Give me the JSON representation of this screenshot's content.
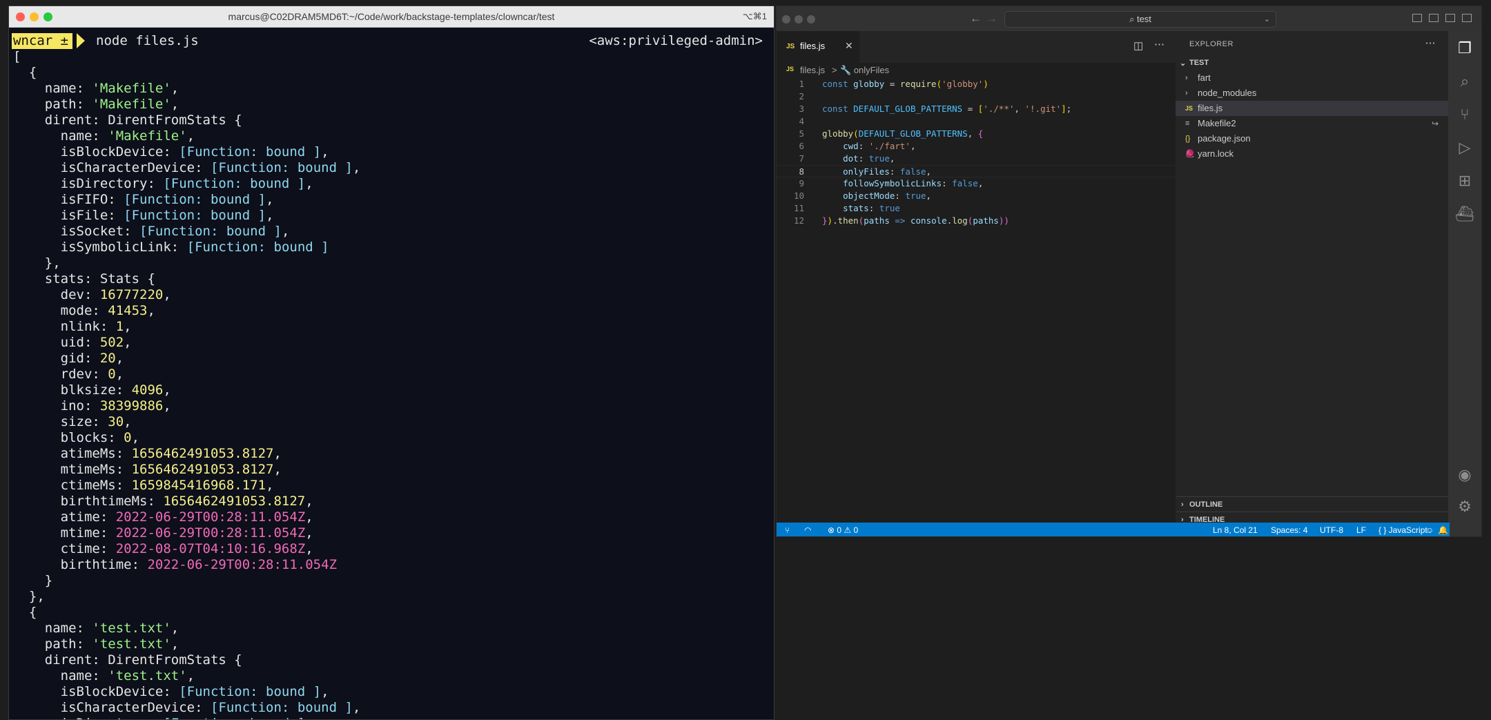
{
  "terminal": {
    "title": "marcus@C02DRAM5MD6T:~/Code/work/backstage-templates/clowncar/test",
    "shortcut": "⌥⌘1",
    "prompt_badge": "wncar ±",
    "command": "node files.js",
    "aws_context": "<aws:privileged-admin>",
    "lines": [
      [
        [
          "t",
          "["
        ]
      ],
      [
        [
          "t",
          "  {"
        ]
      ],
      [
        [
          "t",
          "    name: "
        ],
        [
          "s",
          "'Makefile'"
        ],
        [
          "t",
          ","
        ]
      ],
      [
        [
          "t",
          "    path: "
        ],
        [
          "s",
          "'Makefile'"
        ],
        [
          "t",
          ","
        ]
      ],
      [
        [
          "t",
          "    dirent: DirentFromStats {"
        ]
      ],
      [
        [
          "t",
          "      name: "
        ],
        [
          "s",
          "'Makefile'"
        ],
        [
          "t",
          ","
        ]
      ],
      [
        [
          "t",
          "      isBlockDevice: "
        ],
        [
          "f",
          "[Function: bound ]"
        ],
        [
          "t",
          ","
        ]
      ],
      [
        [
          "t",
          "      isCharacterDevice: "
        ],
        [
          "f",
          "[Function: bound ]"
        ],
        [
          "t",
          ","
        ]
      ],
      [
        [
          "t",
          "      isDirectory: "
        ],
        [
          "f",
          "[Function: bound ]"
        ],
        [
          "t",
          ","
        ]
      ],
      [
        [
          "t",
          "      isFIFO: "
        ],
        [
          "f",
          "[Function: bound ]"
        ],
        [
          "t",
          ","
        ]
      ],
      [
        [
          "t",
          "      isFile: "
        ],
        [
          "f",
          "[Function: bound ]"
        ],
        [
          "t",
          ","
        ]
      ],
      [
        [
          "t",
          "      isSocket: "
        ],
        [
          "f",
          "[Function: bound ]"
        ],
        [
          "t",
          ","
        ]
      ],
      [
        [
          "t",
          "      isSymbolicLink: "
        ],
        [
          "f",
          "[Function: bound ]"
        ]
      ],
      [
        [
          "t",
          "    },"
        ]
      ],
      [
        [
          "t",
          "    stats: Stats {"
        ]
      ],
      [
        [
          "t",
          "      dev: "
        ],
        [
          "n",
          "16777220"
        ],
        [
          "t",
          ","
        ]
      ],
      [
        [
          "t",
          "      mode: "
        ],
        [
          "n",
          "41453"
        ],
        [
          "t",
          ","
        ]
      ],
      [
        [
          "t",
          "      nlink: "
        ],
        [
          "n",
          "1"
        ],
        [
          "t",
          ","
        ]
      ],
      [
        [
          "t",
          "      uid: "
        ],
        [
          "n",
          "502"
        ],
        [
          "t",
          ","
        ]
      ],
      [
        [
          "t",
          "      gid: "
        ],
        [
          "n",
          "20"
        ],
        [
          "t",
          ","
        ]
      ],
      [
        [
          "t",
          "      rdev: "
        ],
        [
          "n",
          "0"
        ],
        [
          "t",
          ","
        ]
      ],
      [
        [
          "t",
          "      blksize: "
        ],
        [
          "n",
          "4096"
        ],
        [
          "t",
          ","
        ]
      ],
      [
        [
          "t",
          "      ino: "
        ],
        [
          "n",
          "38399886"
        ],
        [
          "t",
          ","
        ]
      ],
      [
        [
          "t",
          "      size: "
        ],
        [
          "n",
          "30"
        ],
        [
          "t",
          ","
        ]
      ],
      [
        [
          "t",
          "      blocks: "
        ],
        [
          "n",
          "0"
        ],
        [
          "t",
          ","
        ]
      ],
      [
        [
          "t",
          "      atimeMs: "
        ],
        [
          "n",
          "1656462491053.8127"
        ],
        [
          "t",
          ","
        ]
      ],
      [
        [
          "t",
          "      mtimeMs: "
        ],
        [
          "n",
          "1656462491053.8127"
        ],
        [
          "t",
          ","
        ]
      ],
      [
        [
          "t",
          "      ctimeMs: "
        ],
        [
          "n",
          "1659845416968.171"
        ],
        [
          "t",
          ","
        ]
      ],
      [
        [
          "t",
          "      birthtimeMs: "
        ],
        [
          "n",
          "1656462491053.8127"
        ],
        [
          "t",
          ","
        ]
      ],
      [
        [
          "t",
          "      atime: "
        ],
        [
          "d",
          "2022-06-29T00:28:11.054Z"
        ],
        [
          "t",
          ","
        ]
      ],
      [
        [
          "t",
          "      mtime: "
        ],
        [
          "d",
          "2022-06-29T00:28:11.054Z"
        ],
        [
          "t",
          ","
        ]
      ],
      [
        [
          "t",
          "      ctime: "
        ],
        [
          "d",
          "2022-08-07T04:10:16.968Z"
        ],
        [
          "t",
          ","
        ]
      ],
      [
        [
          "t",
          "      birthtime: "
        ],
        [
          "d",
          "2022-06-29T00:28:11.054Z"
        ]
      ],
      [
        [
          "t",
          "    }"
        ]
      ],
      [
        [
          "t",
          "  },"
        ]
      ],
      [
        [
          "t",
          "  {"
        ]
      ],
      [
        [
          "t",
          "    name: "
        ],
        [
          "s",
          "'test.txt'"
        ],
        [
          "t",
          ","
        ]
      ],
      [
        [
          "t",
          "    path: "
        ],
        [
          "s",
          "'test.txt'"
        ],
        [
          "t",
          ","
        ]
      ],
      [
        [
          "t",
          "    dirent: DirentFromStats {"
        ]
      ],
      [
        [
          "t",
          "      name: "
        ],
        [
          "s",
          "'test.txt'"
        ],
        [
          "t",
          ","
        ]
      ],
      [
        [
          "t",
          "      isBlockDevice: "
        ],
        [
          "f",
          "[Function: bound ]"
        ],
        [
          "t",
          ","
        ]
      ],
      [
        [
          "t",
          "      isCharacterDevice: "
        ],
        [
          "f",
          "[Function: bound ]"
        ],
        [
          "t",
          ","
        ]
      ],
      [
        [
          "t",
          "      isDirectory: "
        ],
        [
          "f",
          "[Function: bound ]"
        ],
        [
          "t",
          ","
        ]
      ]
    ]
  },
  "vscode": {
    "search": "test",
    "tab": {
      "badge": "JS",
      "label": "files.js"
    },
    "breadcrumb": {
      "file": "files.js",
      "separator": ">",
      "symbol": "onlyFiles"
    },
    "active_line": 8,
    "code_lines": [
      [
        [
          "k",
          "const "
        ],
        [
          "v",
          "globby"
        ],
        [
          "t",
          " = "
        ],
        [
          "f",
          "require"
        ],
        [
          "p1",
          "("
        ],
        [
          "s",
          "'globby'"
        ],
        [
          "p1",
          ")"
        ]
      ],
      [],
      [
        [
          "k",
          "const "
        ],
        [
          "cst",
          "DEFAULT_GLOB_PATTERNS"
        ],
        [
          "t",
          " = "
        ],
        [
          "p1",
          "["
        ],
        [
          "s",
          "'./**'"
        ],
        [
          "t",
          ", "
        ],
        [
          "s",
          "'!.git'"
        ],
        [
          "p1",
          "]"
        ],
        [
          "t",
          ";"
        ]
      ],
      [],
      [
        [
          "f",
          "globby"
        ],
        [
          "p1",
          "("
        ],
        [
          "cst",
          "DEFAULT_GLOB_PATTERNS"
        ],
        [
          "t",
          ", "
        ],
        [
          "p2",
          "{"
        ]
      ],
      [
        [
          "t",
          "    "
        ],
        [
          "v",
          "cwd"
        ],
        [
          "t",
          ": "
        ],
        [
          "s",
          "'./fart'"
        ],
        [
          "t",
          ","
        ]
      ],
      [
        [
          "t",
          "    "
        ],
        [
          "v",
          "dot"
        ],
        [
          "t",
          ": "
        ],
        [
          "k",
          "true"
        ],
        [
          "t",
          ","
        ]
      ],
      [
        [
          "t",
          "    "
        ],
        [
          "v",
          "onlyFiles"
        ],
        [
          "t",
          ": "
        ],
        [
          "k",
          "false"
        ],
        [
          "t",
          ","
        ]
      ],
      [
        [
          "t",
          "    "
        ],
        [
          "v",
          "followSymbolicLinks"
        ],
        [
          "t",
          ": "
        ],
        [
          "k",
          "false"
        ],
        [
          "t",
          ","
        ]
      ],
      [
        [
          "t",
          "    "
        ],
        [
          "v",
          "objectMode"
        ],
        [
          "t",
          ": "
        ],
        [
          "k",
          "true"
        ],
        [
          "t",
          ","
        ]
      ],
      [
        [
          "t",
          "    "
        ],
        [
          "v",
          "stats"
        ],
        [
          "t",
          ": "
        ],
        [
          "k",
          "true"
        ]
      ],
      [
        [
          "p2",
          "}"
        ],
        [
          "p1",
          ")"
        ],
        [
          "t",
          "."
        ],
        [
          "f",
          "then"
        ],
        [
          "p2",
          "("
        ],
        [
          "v",
          "paths"
        ],
        [
          "t",
          " "
        ],
        [
          "k",
          "=>"
        ],
        [
          "t",
          " "
        ],
        [
          "v",
          "console"
        ],
        [
          "t",
          "."
        ],
        [
          "f",
          "log"
        ],
        [
          "p2",
          "("
        ],
        [
          "v",
          "paths"
        ],
        [
          "p2",
          ")"
        ],
        [
          "p2",
          ")"
        ]
      ]
    ],
    "explorer": {
      "title": "EXPLORER",
      "folder": "TEST",
      "items": [
        {
          "icon": "›",
          "label": "fart",
          "kind": "folder"
        },
        {
          "icon": "›",
          "label": "node_modules",
          "kind": "folder"
        },
        {
          "icon": "JS",
          "label": "files.js",
          "kind": "js",
          "selected": true
        },
        {
          "icon": "≡",
          "label": "Makefile2",
          "kind": "makefile",
          "extra": "↪"
        },
        {
          "icon": "{}",
          "label": "package.json",
          "kind": "json"
        },
        {
          "icon": "🧶",
          "label": "yarn.lock",
          "kind": "yarn"
        }
      ],
      "outline": "OUTLINE",
      "timeline": "TIMELINE"
    },
    "status": {
      "problems": "⊗ 0 ⚠ 0",
      "position": "Ln 8, Col 21",
      "spaces": "Spaces: 4",
      "encoding": "UTF-8",
      "eol": "LF",
      "language": "{ } JavaScript"
    },
    "colors": {
      "status_bar": "#007acc",
      "editor_bg": "#1e1e1e",
      "sidebar_bg": "#252526",
      "activity_bg": "#333333"
    }
  }
}
